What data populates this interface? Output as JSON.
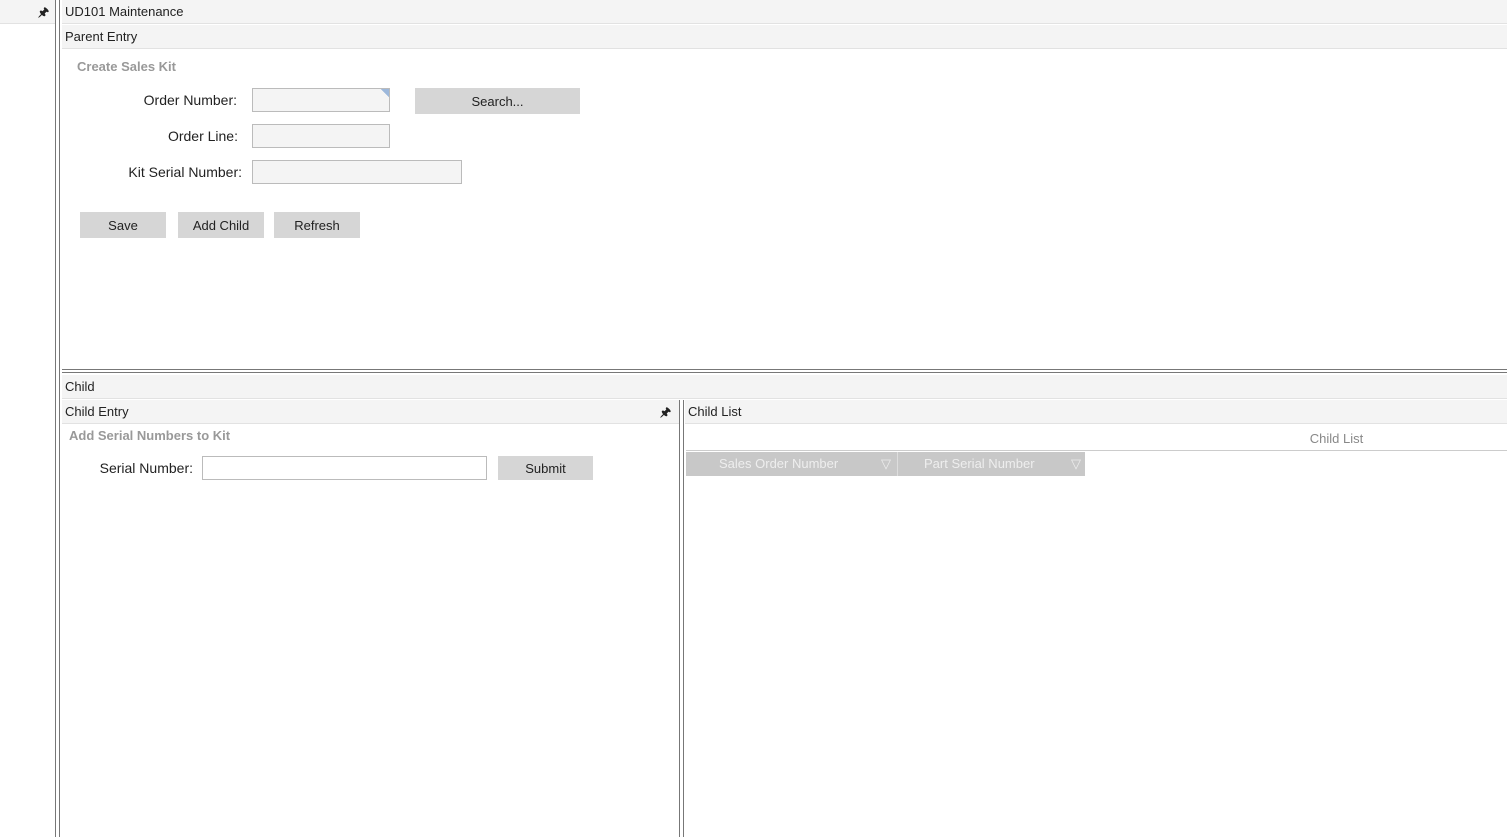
{
  "window": {
    "title": "UD101 Maintenance"
  },
  "parent": {
    "panel_title": "Parent Entry",
    "group_title": "Create Sales Kit",
    "order_number_label": "Order Number:",
    "order_number_value": "",
    "order_line_label": "Order Line:",
    "order_line_value": "",
    "kit_serial_label": "Kit Serial Number:",
    "kit_serial_value": "",
    "search_label": "Search...",
    "save_label": "Save",
    "add_child_label": "Add Child",
    "refresh_label": "Refresh"
  },
  "child": {
    "panel_title": "Child",
    "entry": {
      "title": "Child Entry",
      "group_title": "Add Serial Numbers to Kit",
      "serial_label": "Serial Number:",
      "serial_value": "",
      "submit_label": "Submit"
    },
    "list": {
      "title": "Child List",
      "caption": "Child List",
      "columns": [
        "Sales Order Number",
        "Part Serial Number"
      ]
    }
  },
  "icons": {
    "pin": "pin-icon",
    "filter": "filter-icon"
  }
}
